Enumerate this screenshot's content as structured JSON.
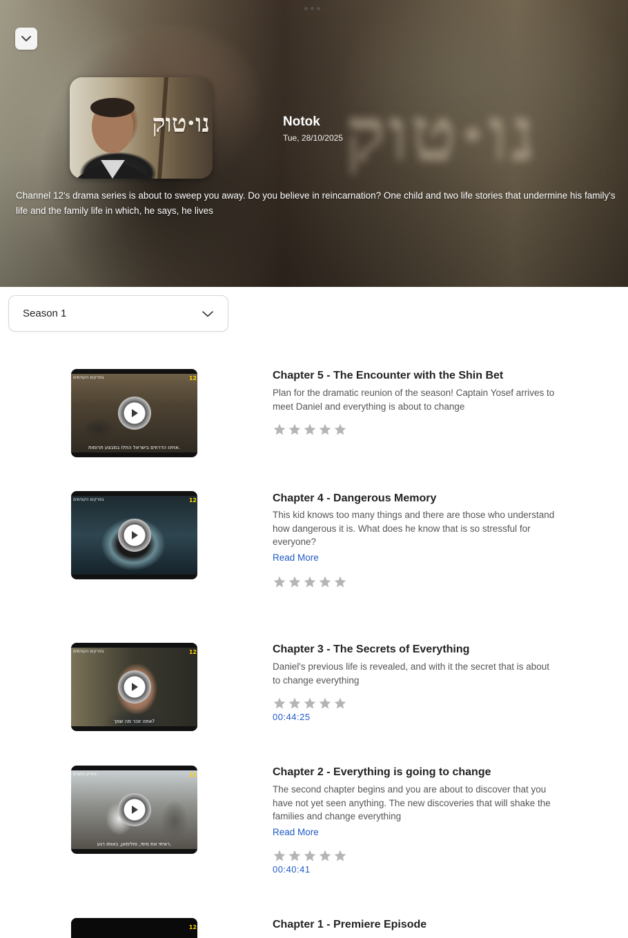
{
  "hero": {
    "title": "Notok",
    "date": "Tue, 28/10/2025",
    "poster_text": "נו·טוק",
    "watermark_text": "נו·טוק",
    "description": "Channel 12's drama series is about to sweep you away. Do you believe in reincarnation? One child and two life stories that undermine his family's life and the family life in which, he says, he lives",
    "collapse_icon": "chevron-down-icon",
    "menu_icon": "more-dots-icon"
  },
  "season_select": {
    "selected": "Season 1",
    "icon": "chevron-down-icon"
  },
  "episodes": [
    {
      "title": "Chapter 5 - The Encounter with the Shin Bet",
      "description": "Plan for the dramatic reunion of the season! Captain Yosef arrives to meet Daniel and everything is about to change",
      "read_more": "",
      "rating": 0,
      "duration": "",
      "thumb_tag": "בפרקים הקודמים",
      "thumb_logo": "12",
      "thumb_sub": "אחינו הדרוזים בישראל החלו במבצע תרומות."
    },
    {
      "title": "Chapter 4 - Dangerous Memory",
      "description": "This kid knows too many things and there are those who understand how dangerous it is. What does he know that is so stressful for everyone?",
      "read_more": "Read More",
      "rating": 0,
      "duration": "",
      "thumb_tag": "בפרקים הקודמים",
      "thumb_logo": "12",
      "thumb_sub": ""
    },
    {
      "title": "Chapter 3 - The Secrets of Everything",
      "description": "Daniel's previous life is revealed, and with it the secret that is about to change everything",
      "read_more": "",
      "rating": 0,
      "duration": "00:44:25",
      "thumb_tag": "בפרקים הקודמים",
      "thumb_logo": "12",
      "thumb_sub": "אתה זוכר מה שמך?"
    },
    {
      "title": "Chapter 2 - Everything is going to change",
      "description": "The second chapter begins and you are about to discover that you have not yet seen anything. The new discoveries that will shake the families and change everything",
      "read_more": "Read More",
      "rating": 0,
      "duration": "00:40:41",
      "thumb_tag": "בפרק הקודם",
      "thumb_logo": "12",
      "thumb_sub": "ראיתי את סימי, סולימאן, באותו רגע."
    },
    {
      "title": "Chapter 1 - Premiere Episode",
      "description": "",
      "read_more": "",
      "rating": 0,
      "duration": "",
      "thumb_tag": "",
      "thumb_logo": "12",
      "thumb_sub": ""
    }
  ],
  "colors": {
    "link": "#1f5ac6",
    "star_empty": "#b5b5b5",
    "title": "#222222",
    "body": "#555555"
  }
}
